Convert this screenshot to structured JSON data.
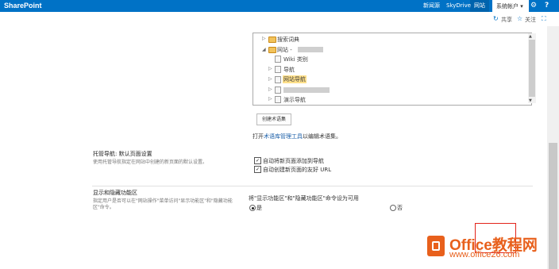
{
  "suitebar": {
    "brand": "SharePoint",
    "nav": [
      "新闻源",
      "SkyDrive",
      "网站"
    ],
    "active_nav": "网站",
    "user": "系统帐户 ▾",
    "icons": [
      "gear-icon",
      "help-icon"
    ],
    "colors": {
      "bar": "#0072c6",
      "accent": "#e2231a"
    }
  },
  "actions": {
    "sync": "同步",
    "share": "共享",
    "follow": "关注",
    "focus_icon": "focus-icon"
  },
  "tree": {
    "items": [
      {
        "label": "搜索词典",
        "toggle": "▷"
      },
      {
        "label": "网站 -",
        "toggle": "◢"
      },
      {
        "label": "Wiki 类别",
        "toggle": ""
      },
      {
        "label": "导航",
        "toggle": "▷"
      },
      {
        "label": "网站导航",
        "toggle": "▷",
        "highlight": true
      },
      {
        "label": "",
        "toggle": "▷"
      },
      {
        "label": "演示导航",
        "toggle": "▷"
      }
    ]
  },
  "create_termset_button": "创建术语集",
  "termstore_hint": {
    "prefix": "打开",
    "link": "术语库管理工具",
    "suffix": "以编辑术语集。"
  },
  "managed_nav": {
    "title": "托管导航: 默认页面设置",
    "desc": "使用托管导航指定在网站中创建的新页面的默认设置。",
    "options": [
      {
        "label": "自动将新页面添加到导航",
        "checked": true
      },
      {
        "label": "自动创建新页面的友好 URL",
        "checked": true
      }
    ]
  },
  "ribbon_section": {
    "title": "显示和隐藏功能区",
    "desc_line1": "指定用户是否可以在\"网站操作\"菜单访问\"显示功能区\"和\"隐藏功能",
    "desc_line2": "区\"命令。",
    "question": "将\"显示功能区\"和\"隐藏功能区\"命令设为可用",
    "yes": "是",
    "no": "否",
    "selected": "是"
  },
  "watermark": {
    "title": "Office教程网",
    "url": "www.office26.com"
  }
}
